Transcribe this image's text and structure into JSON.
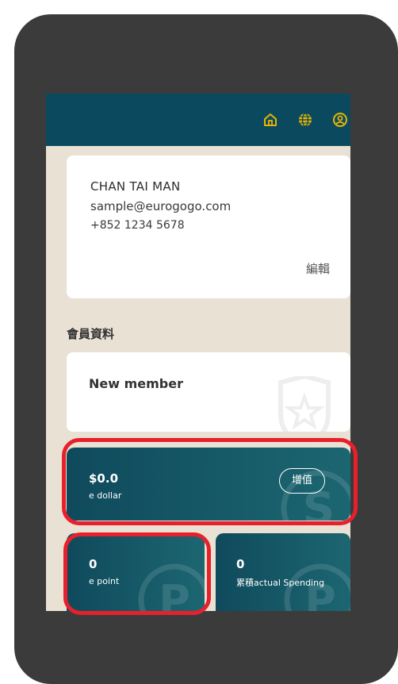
{
  "topbar": {
    "icons": [
      "home-icon",
      "globe-icon",
      "account-icon"
    ],
    "accent_color": "#e8b400",
    "background": "#0b4a5e"
  },
  "profile": {
    "name": "CHAN TAI MAN",
    "email": "sample@eurogogo.com",
    "phone": "+852 1234 5678",
    "edit_label": "編輯"
  },
  "member_section": {
    "title": "會員資料",
    "tier": "New member"
  },
  "wallet": {
    "edollar": {
      "value": "$0.0",
      "label": "e dollar",
      "topup_label": "增值"
    },
    "epoint": {
      "value": "0",
      "label": "e point"
    },
    "spending": {
      "value": "0",
      "label": "累積actual Spending"
    }
  },
  "highlight_color": "#e8202c"
}
